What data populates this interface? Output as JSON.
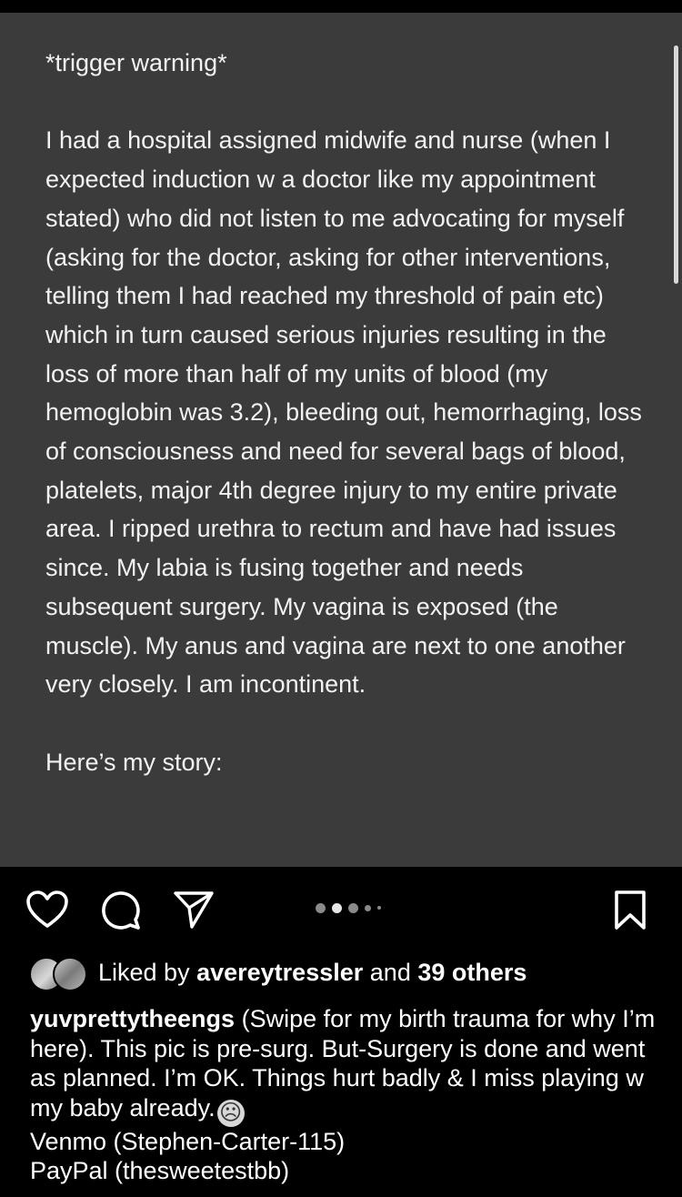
{
  "post": {
    "body_text": "*trigger warning*\n\nI had a hospital assigned midwife and nurse (when I expected induction w a doctor like my appointment stated) who did not listen to me advocating for myself (asking for the doctor, asking for other interventions, telling them I had reached my threshold of pain etc) which in turn caused serious injuries resulting in the loss of more than half of my units of blood (my hemoglobin was 3.2), bleeding out, hemorrhaging, loss of consciousness and need for several bags of blood, platelets, major 4th degree injury to my entire private area. I ripped urethra to rectum and have had issues since. My labia is fusing together and needs subsequent surgery. My vagina is exposed (the muscle). My anus and vagina are next to one another very closely. I am incontinent.\n\nHere’s my story:"
  },
  "actions": {
    "like_icon": "heart-icon",
    "comment_icon": "comment-icon",
    "share_icon": "paper-plane-icon",
    "save_icon": "bookmark-icon"
  },
  "carousel": {
    "dot_count": 5,
    "active_index": 1
  },
  "likes": {
    "prefix": "Liked by",
    "user": "avereytressler",
    "conjunction": "and",
    "others": "39 others"
  },
  "caption": {
    "username": "yuvprettytheengs",
    "text": "(Swipe for my birth trauma for why I’m here). This pic is pre-surg. But-Surgery is done and went as planned. I’m OK. Things hurt badly & I miss playing w my baby already.",
    "emoji": "☹",
    "venmo": "Venmo (Stephen-Carter-115)",
    "paypal": "PayPal (thesweetestbb)"
  }
}
